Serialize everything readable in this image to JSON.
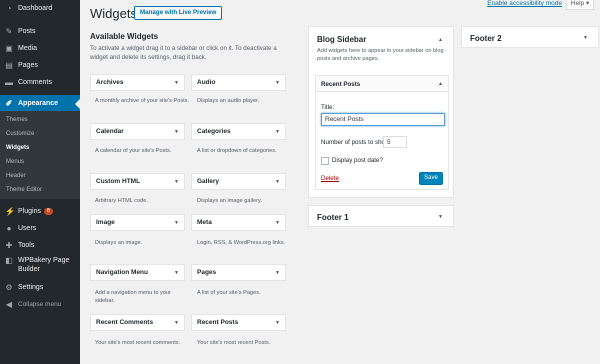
{
  "sidebar": {
    "items": [
      {
        "label": "Dashboard",
        "icon": "dashboard-icon"
      },
      {
        "label": "Posts",
        "icon": "pin-icon"
      },
      {
        "label": "Media",
        "icon": "media-icon"
      },
      {
        "label": "Pages",
        "icon": "page-icon"
      },
      {
        "label": "Comments",
        "icon": "comment-icon"
      },
      {
        "label": "Appearance",
        "icon": "brush-icon"
      },
      {
        "label": "Plugins",
        "icon": "plug-icon",
        "badge": "8"
      },
      {
        "label": "Users",
        "icon": "user-icon"
      },
      {
        "label": "Tools",
        "icon": "wrench-icon"
      },
      {
        "label": "WPBakery Page Builder",
        "icon": "builder-icon"
      },
      {
        "label": "Settings",
        "icon": "settings-icon"
      },
      {
        "label": "Collapse menu",
        "icon": "collapse-icon"
      }
    ],
    "submenu": [
      "Themes",
      "Customize",
      "Widgets",
      "Menus",
      "Header",
      "Theme Editor"
    ]
  },
  "header": {
    "title": "Widgets",
    "live_preview": "Manage with Live Preview",
    "screen_options": "Enable accessibility mode",
    "help": "Help"
  },
  "available": {
    "title": "Available Widgets",
    "description": "To activate a widget drag it to a sidebar or click on it. To deactivate a widget and delete its settings, drag it back.",
    "widgets": [
      {
        "name": "Archives",
        "desc": "A monthly archive of your site's Posts."
      },
      {
        "name": "Audio",
        "desc": "Displays an audio player."
      },
      {
        "name": "Calendar",
        "desc": "A calendar of your site's Posts."
      },
      {
        "name": "Categories",
        "desc": "A list or dropdown of categories."
      },
      {
        "name": "Custom HTML",
        "desc": "Arbitrary HTML code."
      },
      {
        "name": "Gallery",
        "desc": "Displays an image gallery."
      },
      {
        "name": "Image",
        "desc": "Displays an image."
      },
      {
        "name": "Meta",
        "desc": "Login, RSS, & WordPress.org links."
      },
      {
        "name": "Navigation Menu",
        "desc": "Add a navigation menu to your sidebar."
      },
      {
        "name": "Pages",
        "desc": "A list of your site's Pages."
      },
      {
        "name": "Recent Comments",
        "desc": "Your site's most recent comments."
      },
      {
        "name": "Recent Posts",
        "desc": "Your site's most recent Posts."
      }
    ]
  },
  "blog_sidebar": {
    "title": "Blog Sidebar",
    "description": "Add widgets here to appear in your sidebar on blog posts and archive pages.",
    "widget": {
      "title": "Recent Posts",
      "title_label": "Title:",
      "title_value": "Recent Posts",
      "number_label": "Number of posts to show:",
      "number_value": "5",
      "date_label": "Display post date?",
      "delete": "Delete",
      "save": "Save"
    }
  },
  "footer1": {
    "title": "Footer 1"
  },
  "footer2": {
    "title": "Footer 2"
  },
  "colors": {
    "accent": "#0073aa",
    "sidebar": "#23282d",
    "badge": "#ca4a1f",
    "delete": "#a00000"
  }
}
